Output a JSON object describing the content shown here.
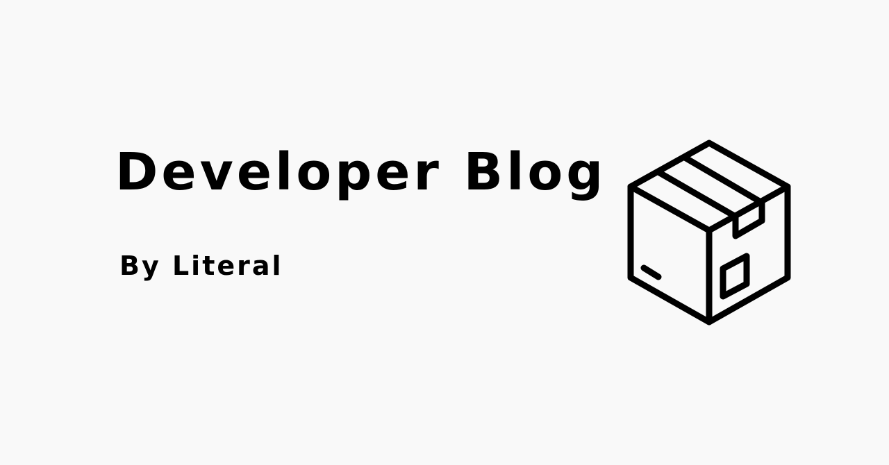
{
  "title": "Developer Blog",
  "byline": "By Literal",
  "icon": "cardboard-box-icon",
  "colors": {
    "background": "#f9f9f9",
    "foreground": "#000000"
  }
}
